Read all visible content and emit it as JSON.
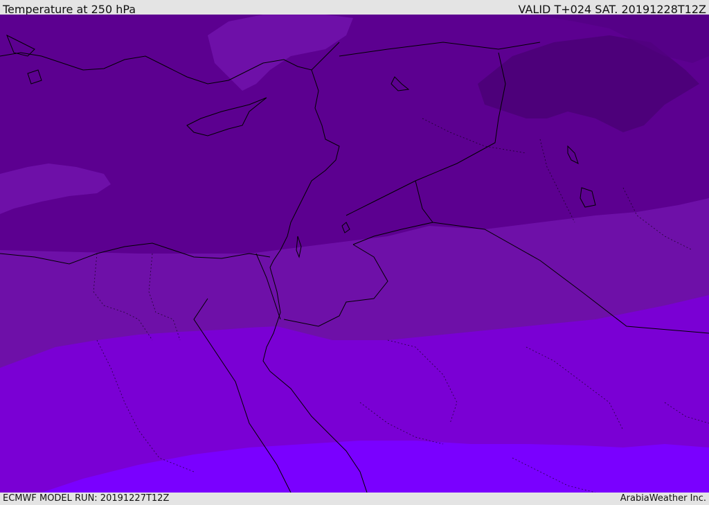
{
  "header": {
    "title": "Temperature at 250 hPa",
    "valid_time": "VALID T+024 SAT. 20191228T12Z"
  },
  "footer": {
    "model_run": "ECMWF MODEL RUN: 20191227T12Z",
    "credit": "ArabiaWeather Inc."
  },
  "map": {
    "variable": "temperature",
    "pressure_level_hpa": 250,
    "colors": {
      "band_coldest": "#4a0077",
      "band_1": "#5c0090",
      "band_2": "#6e10a8",
      "band_3": "#7a00d4",
      "band_4": "#7a00ff",
      "coastline": "#000000",
      "border": "#000000"
    }
  }
}
